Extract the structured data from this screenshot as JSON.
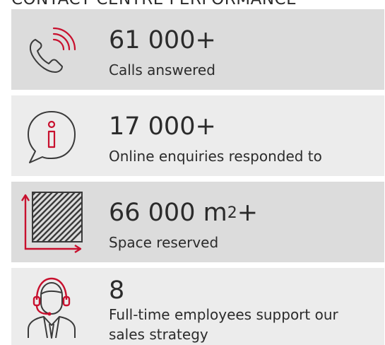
{
  "heading": "CONTACT CENTRE PERFORMANCE",
  "colors": {
    "accent": "#c8102e",
    "band_dark": "#dcdcdc",
    "band_light": "#ececec",
    "icon_stroke": "#3a3a3a",
    "text": "#2b2b2b"
  },
  "stats": [
    {
      "icon": "phone-ringing-icon",
      "figure": "61 000+",
      "caption": "Calls answered"
    },
    {
      "icon": "info-speech-bubble-icon",
      "figure": "17 000+",
      "caption": "Online enquiries responded to"
    },
    {
      "icon": "floor-area-icon",
      "figure_main": "66 000 m",
      "figure_sup": "2",
      "figure_suffix": "+",
      "caption": "Space reserved"
    },
    {
      "icon": "headset-agent-icon",
      "figure": "8",
      "caption_line1": "Full-time employees support our",
      "caption_line2": "sales strategy"
    }
  ]
}
